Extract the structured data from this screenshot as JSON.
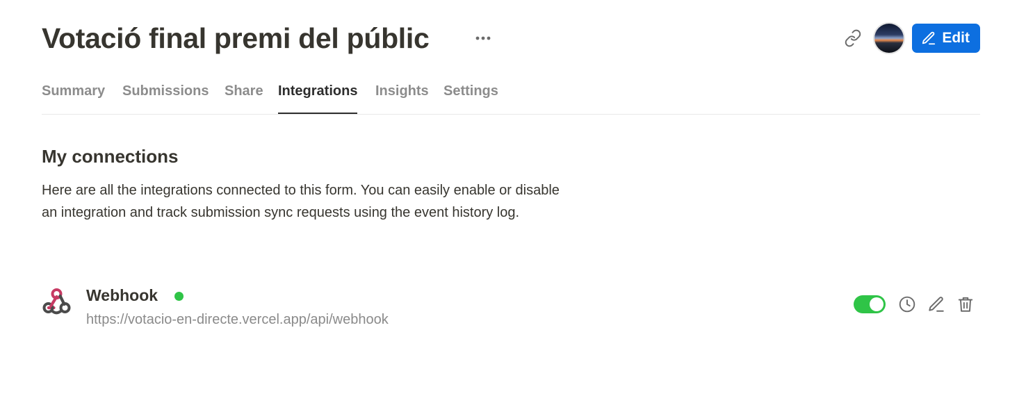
{
  "header": {
    "title": "Votació final premi del públic",
    "edit_label": "Edit"
  },
  "tabs": [
    {
      "label": "Summary",
      "active": false
    },
    {
      "label": "Submissions",
      "active": false
    },
    {
      "label": "Share",
      "active": false
    },
    {
      "label": "Integrations",
      "active": true
    },
    {
      "label": "Insights",
      "active": false
    },
    {
      "label": "Settings",
      "active": false
    }
  ],
  "connections": {
    "title": "My connections",
    "description": "Here are all the integrations connected to this form. You can easily enable or disable an integration and track submission sync requests using the event history log.",
    "items": [
      {
        "name": "Webhook",
        "url": "https://votacio-en-directe.vercel.app/api/webhook",
        "status": "active",
        "enabled": true,
        "icon": "webhook-icon"
      }
    ]
  },
  "colors": {
    "accent": "#0d6fe0",
    "status_green": "#2fc447",
    "text": "#37352f",
    "muted": "#8a8a8a"
  }
}
